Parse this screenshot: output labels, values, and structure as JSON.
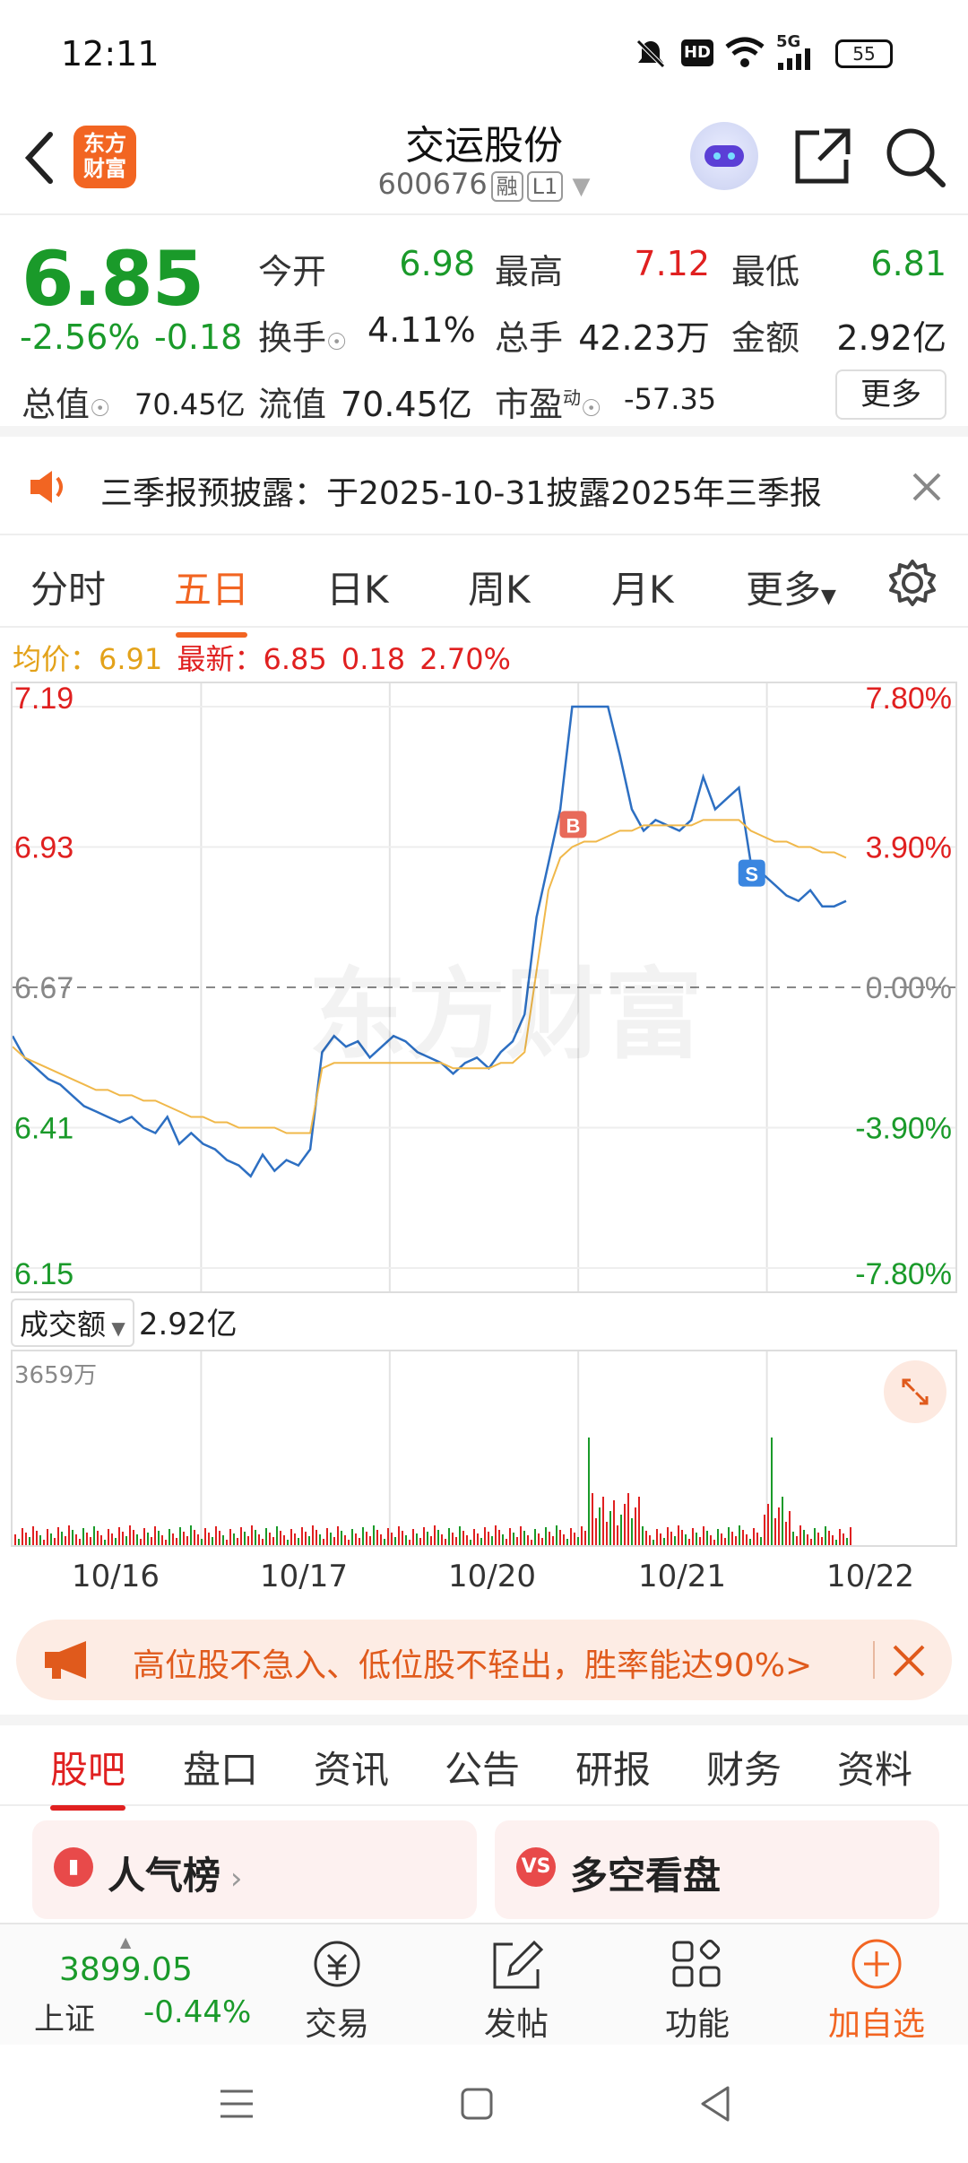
{
  "status": {
    "time": "12:11",
    "battery": "55",
    "network": "5G"
  },
  "header": {
    "logo_line1": "东方",
    "logo_line2": "财富",
    "title": "交运股份",
    "code": "600676",
    "tag1": "融",
    "tag2": "L1"
  },
  "quote": {
    "price": "6.85",
    "change_pct": "-2.56%",
    "change": "-0.18",
    "open_label": "今开",
    "open": "6.98",
    "high_label": "最高",
    "high": "7.12",
    "low_label": "最低",
    "low": "6.81",
    "turnover_label": "换手",
    "turnover": "4.11%",
    "volume_label": "总手",
    "volume": "42.23万",
    "amount_label": "金额",
    "amount": "2.92亿",
    "mcap_label": "总值",
    "mcap": "70.45亿",
    "float_label": "流值",
    "float": "70.45亿",
    "pe_label": "市盈",
    "pe_sup": "动",
    "pe": "-57.35",
    "more": "更多"
  },
  "notice": {
    "text": "三季报预披露：于2025-10-31披露2025年三季报"
  },
  "tabs": [
    "分时",
    "五日",
    "日K",
    "周K",
    "月K",
    "更多"
  ],
  "chart_info": {
    "avg_label": "均价：",
    "avg": "6.91",
    "latest_label": "最新：",
    "latest": "6.85",
    "chg": "0.18",
    "pct": "2.70%"
  },
  "chart_data": {
    "type": "line",
    "title": "",
    "x_dates": [
      "10/16",
      "10/17",
      "10/20",
      "10/21",
      "10/22"
    ],
    "ylim": [
      6.15,
      7.19
    ],
    "y_ticks_left": [
      "7.19",
      "6.93",
      "6.67",
      "6.41",
      "6.15"
    ],
    "y_ticks_right": [
      "7.80%",
      "3.90%",
      "0.00%",
      "-3.90%",
      "-7.80%"
    ],
    "prev_close": 6.67,
    "series": [
      {
        "values": [
          6.58,
          6.54,
          6.52,
          6.5,
          6.49,
          6.47,
          6.45,
          6.44,
          6.43,
          6.42,
          6.43,
          6.41,
          6.4,
          6.43,
          6.38,
          6.4,
          6.38,
          6.37,
          6.35,
          6.34,
          6.32,
          6.36,
          6.33,
          6.35,
          6.34,
          6.37,
          6.55,
          6.58,
          6.56,
          6.57,
          6.54,
          6.56,
          6.58,
          6.57,
          6.55,
          6.54,
          6.53,
          6.51,
          6.53,
          6.54,
          6.52,
          6.55,
          6.57,
          6.62,
          6.8,
          6.9,
          7.0,
          7.19,
          7.19,
          7.19,
          7.19,
          7.1,
          7.0,
          6.96,
          6.98,
          6.97,
          6.96,
          6.98,
          7.06,
          7.0,
          7.02,
          7.04,
          6.9,
          6.88,
          6.86,
          6.84,
          6.83,
          6.85,
          6.82,
          6.82,
          6.83
        ]
      },
      {
        "values": [
          6.56,
          6.54,
          6.53,
          6.52,
          6.51,
          6.5,
          6.49,
          6.48,
          6.48,
          6.47,
          6.47,
          6.46,
          6.46,
          6.45,
          6.44,
          6.43,
          6.43,
          6.42,
          6.42,
          6.41,
          6.41,
          6.41,
          6.41,
          6.4,
          6.4,
          6.4,
          6.52,
          6.53,
          6.53,
          6.53,
          6.53,
          6.53,
          6.53,
          6.53,
          6.53,
          6.53,
          6.53,
          6.52,
          6.52,
          6.52,
          6.52,
          6.53,
          6.53,
          6.55,
          6.7,
          6.85,
          6.91,
          6.93,
          6.94,
          6.94,
          6.95,
          6.96,
          6.96,
          6.97,
          6.97,
          6.97,
          6.97,
          6.97,
          6.98,
          6.98,
          6.98,
          6.98,
          6.96,
          6.95,
          6.94,
          6.94,
          6.93,
          6.93,
          6.92,
          6.92,
          6.91
        ]
      }
    ],
    "markers": [
      {
        "label": "B",
        "value": 6.97
      },
      {
        "label": "S",
        "value": 6.88
      }
    ]
  },
  "volume": {
    "label": "成交额",
    "value": "2.92亿",
    "max": "3659万"
  },
  "banner": {
    "text": "高位股不急入、低位股不轻出，胜率能达90%>"
  },
  "bottom_tabs": [
    "股吧",
    "盘口",
    "资讯",
    "公告",
    "研报",
    "财务",
    "资料"
  ],
  "cards": [
    {
      "label": "人气榜"
    },
    {
      "label": "多空看盘"
    }
  ],
  "index": {
    "value": "3899.05",
    "name": "上证",
    "change": "-0.44%"
  },
  "nav": [
    "交易",
    "发帖",
    "功能",
    "加自选"
  ]
}
